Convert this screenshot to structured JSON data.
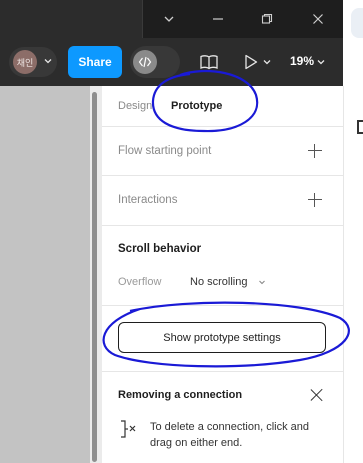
{
  "window_controls": {
    "chevron": "chevron-down-icon",
    "minimize": "minimize-icon",
    "restore": "restore-icon",
    "close": "close-icon"
  },
  "toolbar": {
    "avatar_text": "채인",
    "share_label": "Share",
    "code_icon": "code-icon",
    "library_icon": "book-icon",
    "present_icon": "play-icon",
    "zoom": "19%"
  },
  "panel": {
    "tabs": {
      "design": "Design",
      "prototype": "Prototype"
    },
    "flow_label": "Flow starting point",
    "interactions_label": "Interactions",
    "scroll_title": "Scroll behavior",
    "overflow_label": "Overflow",
    "overflow_value": "No scrolling",
    "proto_button": "Show prototype settings",
    "hint_title": "Removing a connection",
    "hint_text": "To delete a connection, click and drag on either end."
  },
  "colors": {
    "accent": "#0d99ff",
    "annotation": "#1a1ad6"
  }
}
